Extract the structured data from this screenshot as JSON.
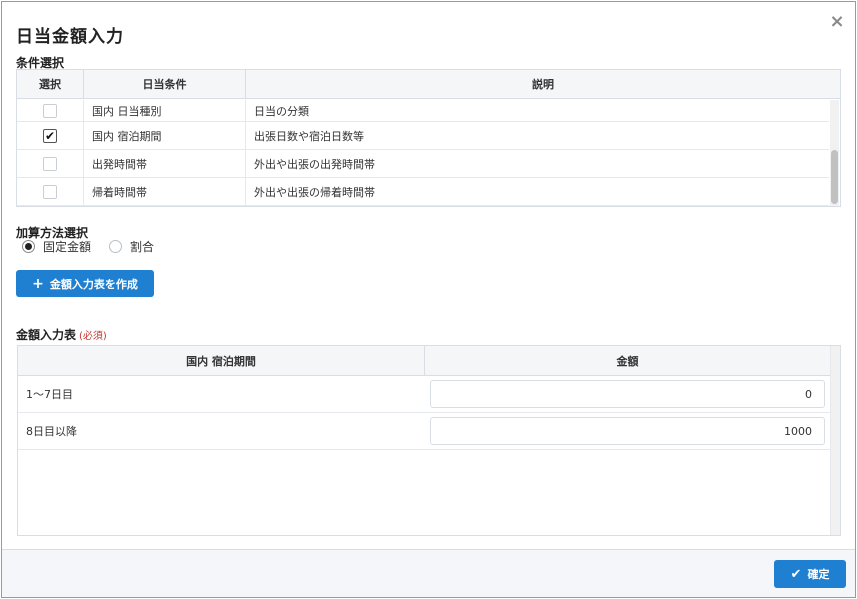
{
  "dialog": {
    "title": "日当金額入力",
    "close_glyph": "×"
  },
  "conditions": {
    "section_label": "条件選択",
    "headers": {
      "select": "選択",
      "condition": "日当条件",
      "description": "説明"
    },
    "rows": [
      {
        "checked": false,
        "condition": "国内 日当種別",
        "description": "日当の分類"
      },
      {
        "checked": true,
        "condition": "国内 宿泊期間",
        "description": "出張日数や宿泊日数等"
      },
      {
        "checked": false,
        "condition": "出発時間帯",
        "description": "外出や出張の出発時間帯"
      },
      {
        "checked": false,
        "condition": "帰着時間帯",
        "description": "外出や出張の帰着時間帯"
      }
    ],
    "check_glyph": "✔"
  },
  "method": {
    "section_label": "加算方法選択",
    "options": [
      {
        "label": "固定金額",
        "selected": true
      },
      {
        "label": "割合",
        "selected": false
      }
    ]
  },
  "create_button": {
    "icon": "plus-icon",
    "label": "金額入力表を作成"
  },
  "amount_table": {
    "section_label": "金額入力表",
    "required_label": "(必須)",
    "headers": {
      "period": "国内 宿泊期間",
      "amount": "金額"
    },
    "rows": [
      {
        "period": "1〜7日目",
        "amount": "0"
      },
      {
        "period": "8日目以降",
        "amount": "1000"
      }
    ]
  },
  "footer": {
    "confirm_icon": "check-icon",
    "confirm_label": "確定"
  },
  "colors": {
    "primary_button": "#1f7fd1",
    "required": "#c23934"
  }
}
